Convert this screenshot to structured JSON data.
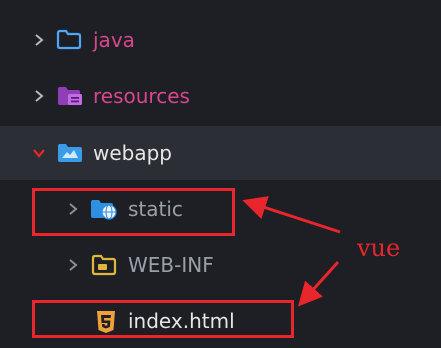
{
  "tree": {
    "items": [
      {
        "label": "java",
        "color": "#d9468c",
        "state": "collapsed",
        "icon": "folder-outline-icon"
      },
      {
        "label": "resources",
        "color": "#d9468c",
        "state": "collapsed",
        "icon": "resources-folder-icon"
      },
      {
        "label": "webapp",
        "color": "#e6e6e6",
        "state": "expanded",
        "icon": "web-folder-icon",
        "chevron_color": "#e8262b"
      },
      {
        "label": "static",
        "color": "#9aa0a8",
        "state": "collapsed",
        "icon": "globe-folder-icon"
      },
      {
        "label": "WEB-INF",
        "color": "#9aa0a8",
        "state": "collapsed",
        "icon": "config-folder-icon"
      },
      {
        "label": "index.html",
        "color": "#e6e6e6",
        "icon": "html5-icon"
      }
    ]
  },
  "annotation": {
    "label": "vue",
    "color": "#e8262b"
  }
}
